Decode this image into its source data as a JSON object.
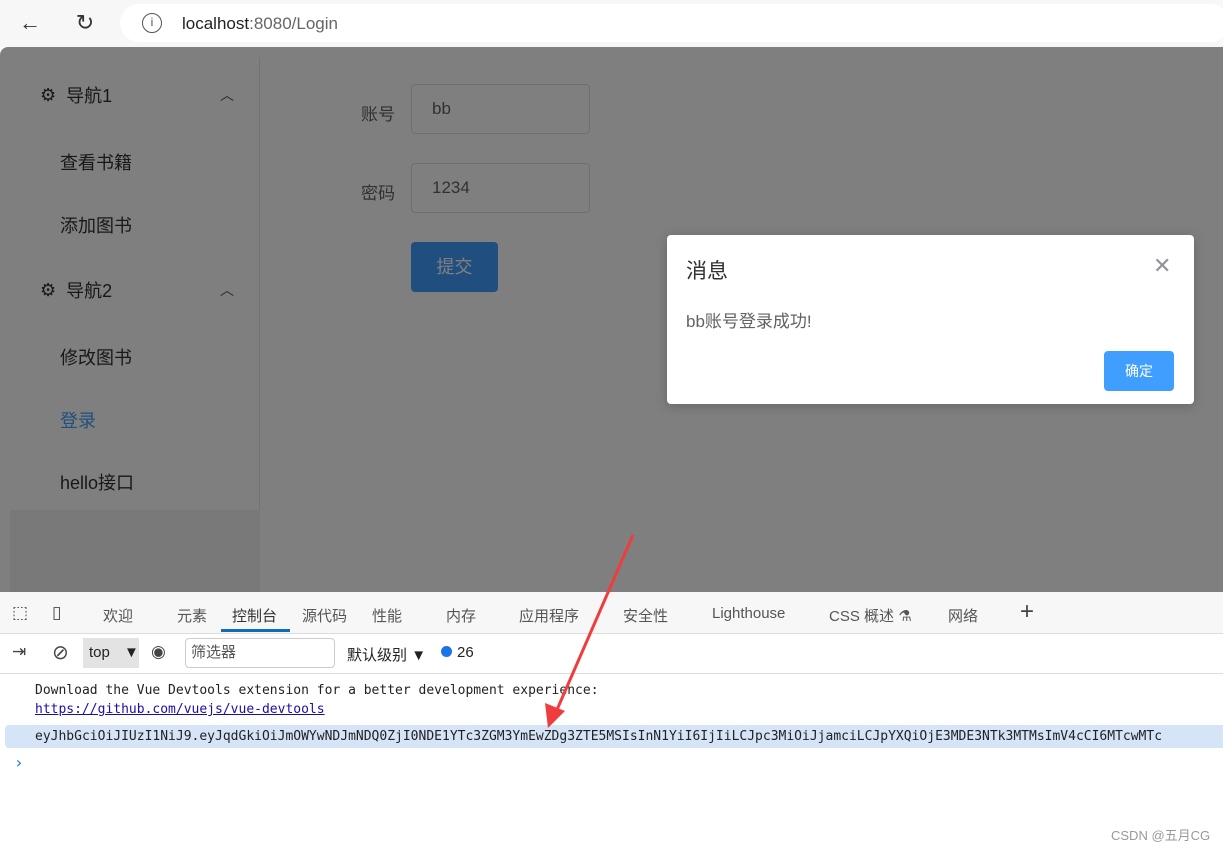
{
  "browser": {
    "url_host": "localhost",
    "url_rest": ":8080/Login"
  },
  "sidebar": {
    "groups": [
      {
        "label": "导航1",
        "items": [
          "查看书籍",
          "添加图书"
        ]
      },
      {
        "label": "导航2",
        "items": [
          "修改图书",
          "登录",
          "hello接口"
        ]
      }
    ],
    "active": "登录"
  },
  "form": {
    "account_label": "账号",
    "account_value": "bb",
    "password_label": "密码",
    "password_value": "1234",
    "submit": "提交"
  },
  "dialog": {
    "title": "消息",
    "message": "bb账号登录成功!",
    "confirm": "确定"
  },
  "devtools": {
    "tabs": [
      "欢迎",
      "元素",
      "控制台",
      "源代码",
      "性能",
      "内存",
      "应用程序",
      "安全性",
      "Lighthouse",
      "CSS 概述",
      "网络"
    ],
    "active_tab": "控制台",
    "context": "top",
    "filter_placeholder": "筛选器",
    "level": "默认级别",
    "message_count": "26",
    "logs": {
      "line1": "Download the Vue Devtools extension for a better development experience:",
      "link": "https://github.com/vuejs/vue-devtools",
      "token": "eyJhbGciOiJIUzI1NiJ9.eyJqdGkiOiJmOWYwNDJmNDQ0ZjI0NDE1YTc3ZGM3YmEwZDg3ZTE5MSIsInN1YiI6IjIiLCJpc3MiOiJjamciLCJpYXQiOjE3MDE3NTk3MTMsImV4cCI6MTcwMTc"
    }
  },
  "colors": {
    "primary": "#409eff",
    "annotation_arrow": "#f03c3c"
  },
  "watermark": "CSDN @五月CG"
}
